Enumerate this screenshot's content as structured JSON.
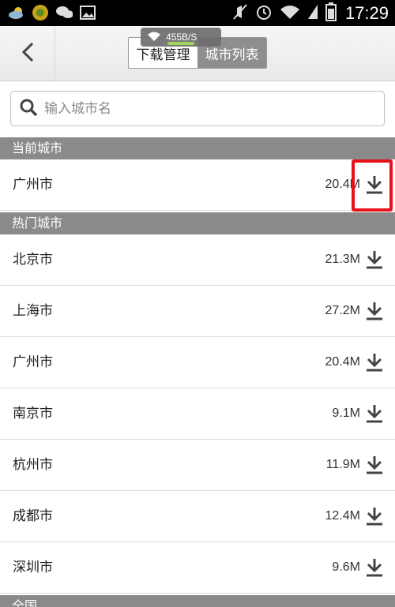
{
  "status_bar": {
    "time": "17:29",
    "icons_left": [
      "weather-icon",
      "app-icon",
      "wechat-icon",
      "image-icon"
    ],
    "icons_right": [
      "mute-icon",
      "alarm-icon",
      "wifi-icon",
      "signal-icon",
      "battery-icon"
    ]
  },
  "net_speed": "455B/S",
  "header": {
    "tabs": [
      {
        "label": "下载管理",
        "active": true
      },
      {
        "label": "城市列表",
        "active": false
      }
    ]
  },
  "search": {
    "placeholder": "输入城市名",
    "value": ""
  },
  "current_section": {
    "title": "当前城市",
    "items": [
      {
        "name": "广州市",
        "size": "20.4M"
      }
    ]
  },
  "hot_section": {
    "title": "热门城市",
    "items": [
      {
        "name": "北京市",
        "size": "21.3M"
      },
      {
        "name": "上海市",
        "size": "27.2M"
      },
      {
        "name": "广州市",
        "size": "20.4M"
      },
      {
        "name": "南京市",
        "size": "9.1M"
      },
      {
        "name": "杭州市",
        "size": "11.9M"
      },
      {
        "name": "成都市",
        "size": "12.4M"
      },
      {
        "name": "深圳市",
        "size": "9.6M"
      }
    ]
  },
  "next_section": {
    "title": "全国"
  },
  "colors": {
    "section_header": "#8a8a8a",
    "highlight": "#e8101a"
  }
}
